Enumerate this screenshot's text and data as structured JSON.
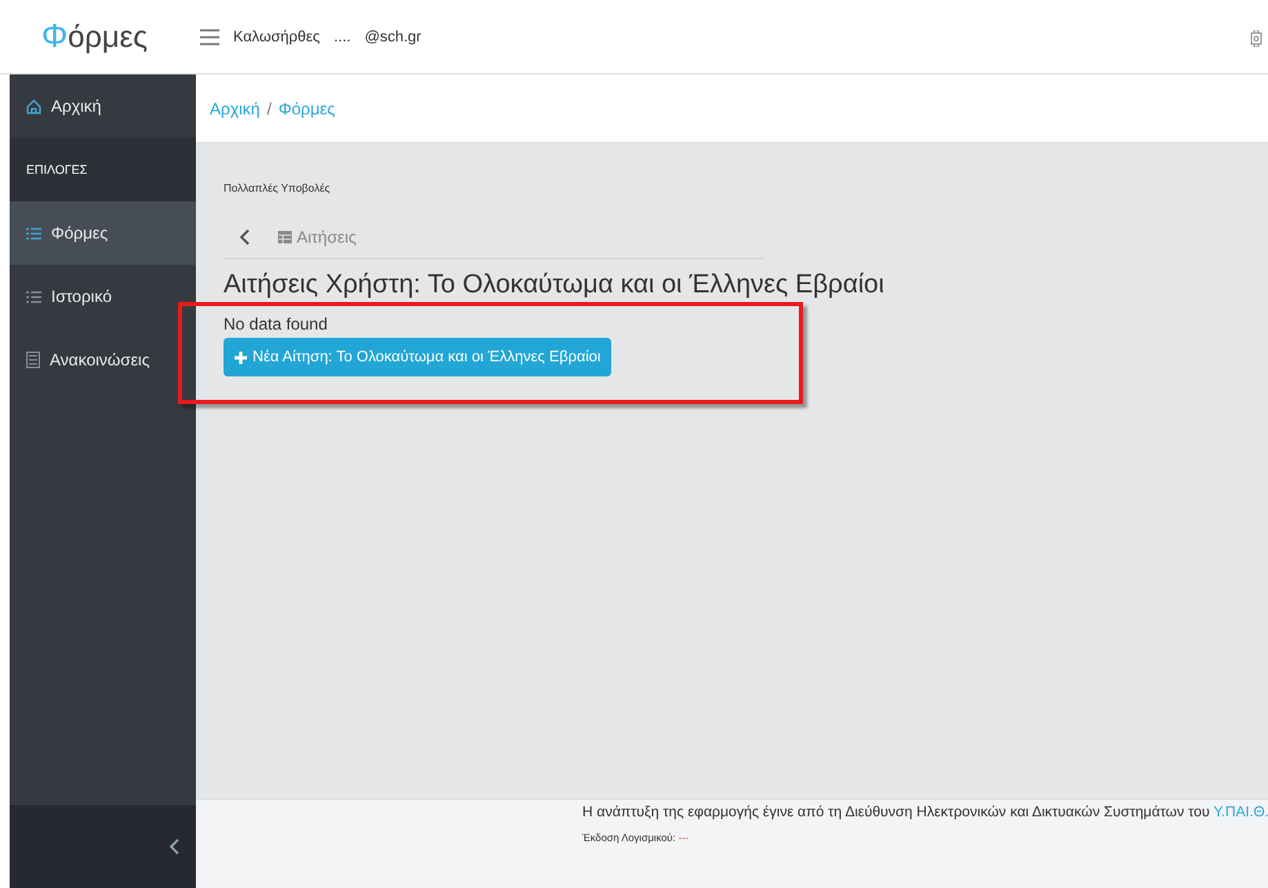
{
  "header": {
    "logo_initial": "Φ",
    "logo_rest": "όρμες",
    "greeting": "Καλωσήρθες",
    "user_name": "....",
    "user_email": "@sch.gr"
  },
  "sidebar": {
    "items": [
      {
        "kind": "home",
        "label": "Αρχική",
        "selected": false
      },
      {
        "kind": "section",
        "label": "ΕΠΙΛΟΓΕΣ"
      },
      {
        "kind": "list",
        "label": "Φόρμες",
        "selected": true
      },
      {
        "kind": "list",
        "label": "Ιστορικό",
        "selected": false
      },
      {
        "kind": "notice",
        "label": "Ανακοινώσεις",
        "selected": false
      }
    ]
  },
  "breadcrumb": {
    "items": [
      "Αρχική",
      "Φόρμες"
    ],
    "separator": "/"
  },
  "content": {
    "subtitle": "Πολλαπλές Υποβολές",
    "tab_label": "Αιτήσεις",
    "title": "Αιτήσεις Χρήστη: Το Ολοκαύτωμα και οι Έλληνες Εβραίοι",
    "empty_message": "No data found",
    "new_button": "Νέα Αίτηση: Το Ολοκαύτωμα και οι Έλληνες Εβραίοι",
    "highlighted": true
  },
  "footer": {
    "credit": "Η ανάπτυξη της εφαρμογής έγινε από τη Διεύθυνση Ηλεκτρονικών και Δικτυακών Συστημάτων του",
    "credit_link": "Υ.ΠΑΙ.Θ.",
    "version_label": "Έκδοση Λογισμικού:",
    "version_value": "---"
  }
}
